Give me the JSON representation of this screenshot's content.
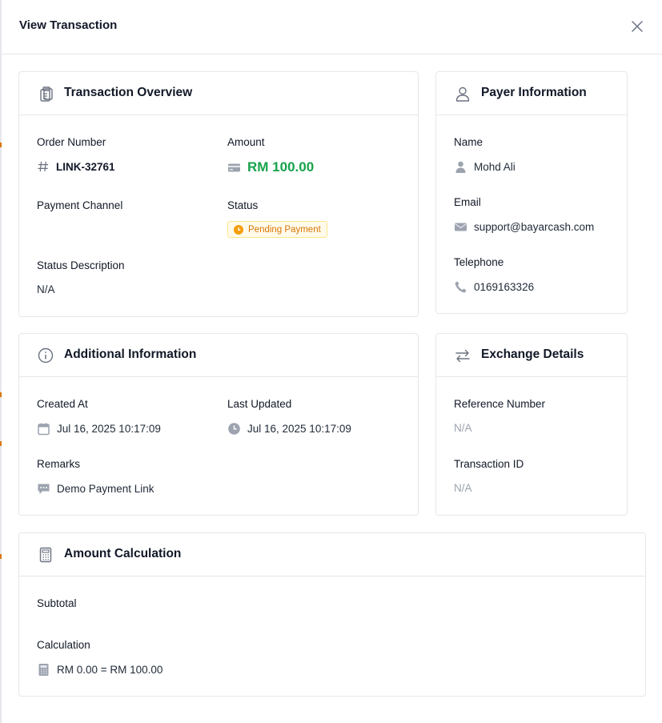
{
  "modal": {
    "title": "View Transaction"
  },
  "overview": {
    "title": "Transaction Overview",
    "order_number_label": "Order Number",
    "order_number": "LINK-32761",
    "amount_label": "Amount",
    "amount": "RM 100.00",
    "payment_channel_label": "Payment Channel",
    "payment_channel": "",
    "status_label": "Status",
    "status": "Pending Payment",
    "status_description_label": "Status Description",
    "status_description": "N/A"
  },
  "payer": {
    "title": "Payer Information",
    "name_label": "Name",
    "name": "Mohd Ali",
    "email_label": "Email",
    "email": "support@bayarcash.com",
    "telephone_label": "Telephone",
    "telephone": "0169163326"
  },
  "additional": {
    "title": "Additional Information",
    "created_at_label": "Created At",
    "created_at": "Jul 16, 2025 10:17:09",
    "last_updated_label": "Last Updated",
    "last_updated": "Jul 16, 2025 10:17:09",
    "remarks_label": "Remarks",
    "remarks": "Demo Payment Link"
  },
  "exchange": {
    "title": "Exchange Details",
    "reference_number_label": "Reference Number",
    "reference_number": "N/A",
    "transaction_id_label": "Transaction ID",
    "transaction_id": "N/A"
  },
  "calculation": {
    "title": "Amount Calculation",
    "subtotal_label": "Subtotal",
    "subtotal": "",
    "calculation_label": "Calculation",
    "calculation": "RM 0.00 = RM 100.00"
  },
  "colors": {
    "amount": "#16a34a",
    "status_text": "#d97706",
    "status_bg": "#fffbeb",
    "status_border": "#fde68a",
    "muted": "#9ca3af",
    "border": "#e5e7eb"
  },
  "icons": {
    "close": "close-icon",
    "overview": "clipboard-icon",
    "payer": "user-icon",
    "additional": "info-icon",
    "exchange": "exchange-arrows-icon",
    "calculation": "calculator-icon",
    "order_number": "hash-icon",
    "amount": "credit-card-icon",
    "status": "clock-icon",
    "name": "person-icon",
    "email": "envelope-icon",
    "telephone": "phone-icon",
    "created_at": "calendar-icon",
    "last_updated": "clock-icon",
    "remarks": "chat-bubble-icon",
    "calc_value": "calculator-icon"
  }
}
